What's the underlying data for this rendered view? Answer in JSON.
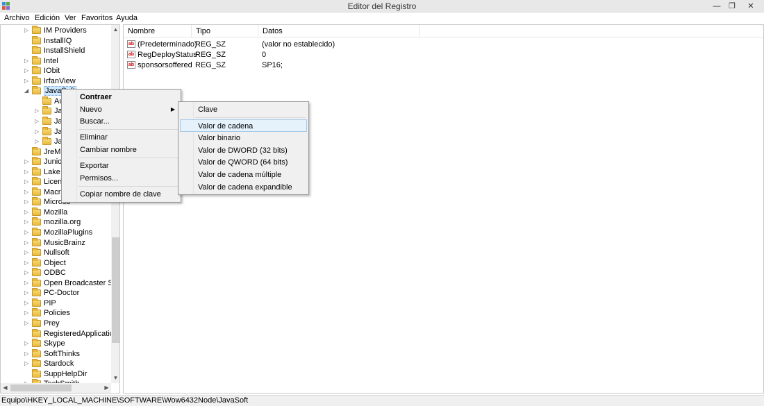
{
  "window": {
    "title": "Editor del Registro",
    "controls": {
      "minimize": "—",
      "maximize": "❐",
      "close": "✕"
    }
  },
  "menubar": [
    "Archivo",
    "Edición",
    "Ver",
    "Favoritos",
    "Ayuda"
  ],
  "tree": {
    "items": [
      {
        "label": "IM Providers",
        "level": 0,
        "expandable": true
      },
      {
        "label": "InstallIQ",
        "level": 0,
        "expandable": false
      },
      {
        "label": "InstallShield",
        "level": 0,
        "expandable": false
      },
      {
        "label": "Intel",
        "level": 0,
        "expandable": true
      },
      {
        "label": "IObit",
        "level": 0,
        "expandable": true
      },
      {
        "label": "IrfanView",
        "level": 0,
        "expandable": true
      },
      {
        "label": "JavaSoft",
        "level": 0,
        "expandable": true,
        "expanded": true,
        "selected": true
      },
      {
        "label": "Au",
        "level": 1,
        "expandable": false
      },
      {
        "label": "Jav",
        "level": 1,
        "expandable": true
      },
      {
        "label": "Jav",
        "level": 1,
        "expandable": true
      },
      {
        "label": "Jav",
        "level": 1,
        "expandable": true
      },
      {
        "label": "Jav",
        "level": 1,
        "expandable": true
      },
      {
        "label": "JreMe",
        "level": 0,
        "expandable": false
      },
      {
        "label": "Junior",
        "level": 0,
        "expandable": true
      },
      {
        "label": "Lake",
        "level": 0,
        "expandable": true
      },
      {
        "label": "Licens",
        "level": 0,
        "expandable": true
      },
      {
        "label": "Macro",
        "level": 0,
        "expandable": true
      },
      {
        "label": "Microso",
        "level": 0,
        "expandable": true
      },
      {
        "label": "Mozilla",
        "level": 0,
        "expandable": true
      },
      {
        "label": "mozilla.org",
        "level": 0,
        "expandable": true
      },
      {
        "label": "MozillaPlugins",
        "level": 0,
        "expandable": true
      },
      {
        "label": "MusicBrainz",
        "level": 0,
        "expandable": true
      },
      {
        "label": "Nullsoft",
        "level": 0,
        "expandable": true
      },
      {
        "label": "Object",
        "level": 0,
        "expandable": true
      },
      {
        "label": "ODBC",
        "level": 0,
        "expandable": true
      },
      {
        "label": "Open Broadcaster Softw",
        "level": 0,
        "expandable": true
      },
      {
        "label": "PC-Doctor",
        "level": 0,
        "expandable": true
      },
      {
        "label": "PIP",
        "level": 0,
        "expandable": true
      },
      {
        "label": "Policies",
        "level": 0,
        "expandable": true
      },
      {
        "label": "Prey",
        "level": 0,
        "expandable": true
      },
      {
        "label": "RegisteredApplications",
        "level": 0,
        "expandable": false
      },
      {
        "label": "Skype",
        "level": 0,
        "expandable": true
      },
      {
        "label": "SoftThinks",
        "level": 0,
        "expandable": true
      },
      {
        "label": "Stardock",
        "level": 0,
        "expandable": true
      },
      {
        "label": "SuppHelpDir",
        "level": 0,
        "expandable": false
      },
      {
        "label": "TechSmith",
        "level": 0,
        "expandable": true
      }
    ]
  },
  "list": {
    "columns": [
      "Nombre",
      "Tipo",
      "Datos"
    ],
    "rows": [
      {
        "name": "(Predeterminado)",
        "type": "REG_SZ",
        "data": "(valor no establecido)"
      },
      {
        "name": "RegDeployStatus",
        "type": "REG_SZ",
        "data": "0"
      },
      {
        "name": "sponsorsoffered",
        "type": "REG_SZ",
        "data": "SP16;"
      }
    ],
    "value_icon": "ab"
  },
  "context_menu": {
    "items": [
      "Contraer",
      "Nuevo",
      "Buscar...",
      "Eliminar",
      "Cambiar nombre",
      "Exportar",
      "Permisos...",
      "Copiar nombre de clave"
    ]
  },
  "submenu": {
    "items": [
      "Clave",
      "Valor de cadena",
      "Valor binario",
      "Valor de DWORD (32 bits)",
      "Valor de QWORD (64 bits)",
      "Valor de cadena múltiple",
      "Valor de cadena expandible"
    ]
  },
  "statusbar": {
    "path": "Equipo\\HKEY_LOCAL_MACHINE\\SOFTWARE\\Wow6432Node\\JavaSoft"
  },
  "colors": {
    "selection": "#cce8ff",
    "menu_highlight": "#e5f1fb",
    "folder": "#e8b93c"
  }
}
